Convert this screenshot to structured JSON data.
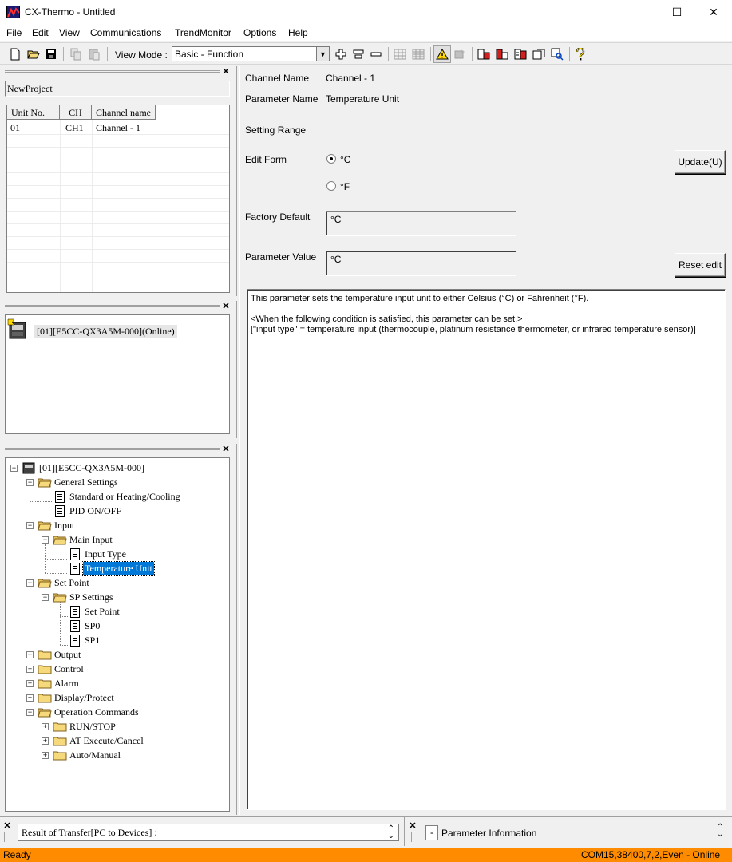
{
  "window": {
    "title": "CX-Thermo - Untitled",
    "minimize": "—",
    "maximize": "☐",
    "close": "✕"
  },
  "menu": [
    "File",
    "Edit",
    "View",
    "Communications",
    "TrendMonitor",
    "Options",
    "Help"
  ],
  "toolbar": {
    "view_mode_label": "View Mode :",
    "view_mode_value": "Basic - Function"
  },
  "project": {
    "name": "NewProject"
  },
  "unit_grid": {
    "headers": [
      "Unit No.",
      "CH",
      "Channel name"
    ],
    "rows": [
      {
        "unit": "01",
        "ch": "CH1",
        "name": "Channel - 1"
      }
    ]
  },
  "device": {
    "label": "[01][E5CC-QX3A5M-000](Online)"
  },
  "tree": {
    "root": "[01][E5CC-QX3A5M-000]",
    "general_settings": "General Settings",
    "standard_heating": "Standard or Heating/Cooling",
    "pid_onoff": "PID ON/OFF",
    "input": "Input",
    "main_input": "Main Input",
    "input_type": "Input Type",
    "temperature_unit": "Temperature Unit",
    "set_point": "Set Point",
    "sp_settings": "SP Settings",
    "set_point_item": "Set Point",
    "sp0": "SP0",
    "sp1": "SP1",
    "output": "Output",
    "control": "Control",
    "alarm": "Alarm",
    "display_protect": "Display/Protect",
    "operation_commands": "Operation Commands",
    "run_stop": "RUN/STOP",
    "at_execute": "AT Execute/Cancel",
    "auto_manual": "Auto/Manual"
  },
  "detail": {
    "channel_name_label": "Channel Name",
    "channel_name_value": "Channel - 1",
    "parameter_name_label": "Parameter Name",
    "parameter_name_value": "Temperature Unit",
    "setting_range_label": "Setting Range",
    "edit_form_label": "Edit Form",
    "option_c": "°C",
    "option_f": "°F",
    "selected": "°C",
    "update_button": "Update(U)",
    "factory_default_label": "Factory Default",
    "factory_default_value": "°C",
    "parameter_value_label": "Parameter Value",
    "parameter_value_value": "°C",
    "reset_button": "Reset edit",
    "description": [
      "This parameter sets the temperature input unit to either Celsius (°C) or Fahrenheit (°F).",
      "",
      "<When the following condition is satisfied, this parameter can be set.>",
      "[\"input type\" = temperature input (thermocouple, platinum resistance thermometer, or infrared temperature sensor)]"
    ]
  },
  "bottom": {
    "transfer_result": "Result of Transfer[PC to Devices] :",
    "param_info_minus": "-",
    "param_info": "Parameter Information"
  },
  "status": {
    "left": "Ready",
    "right": "COM15,38400,7,2,Even - Online"
  },
  "colors": {
    "status_bar": "#ff8c00",
    "selection": "#0078d7"
  }
}
